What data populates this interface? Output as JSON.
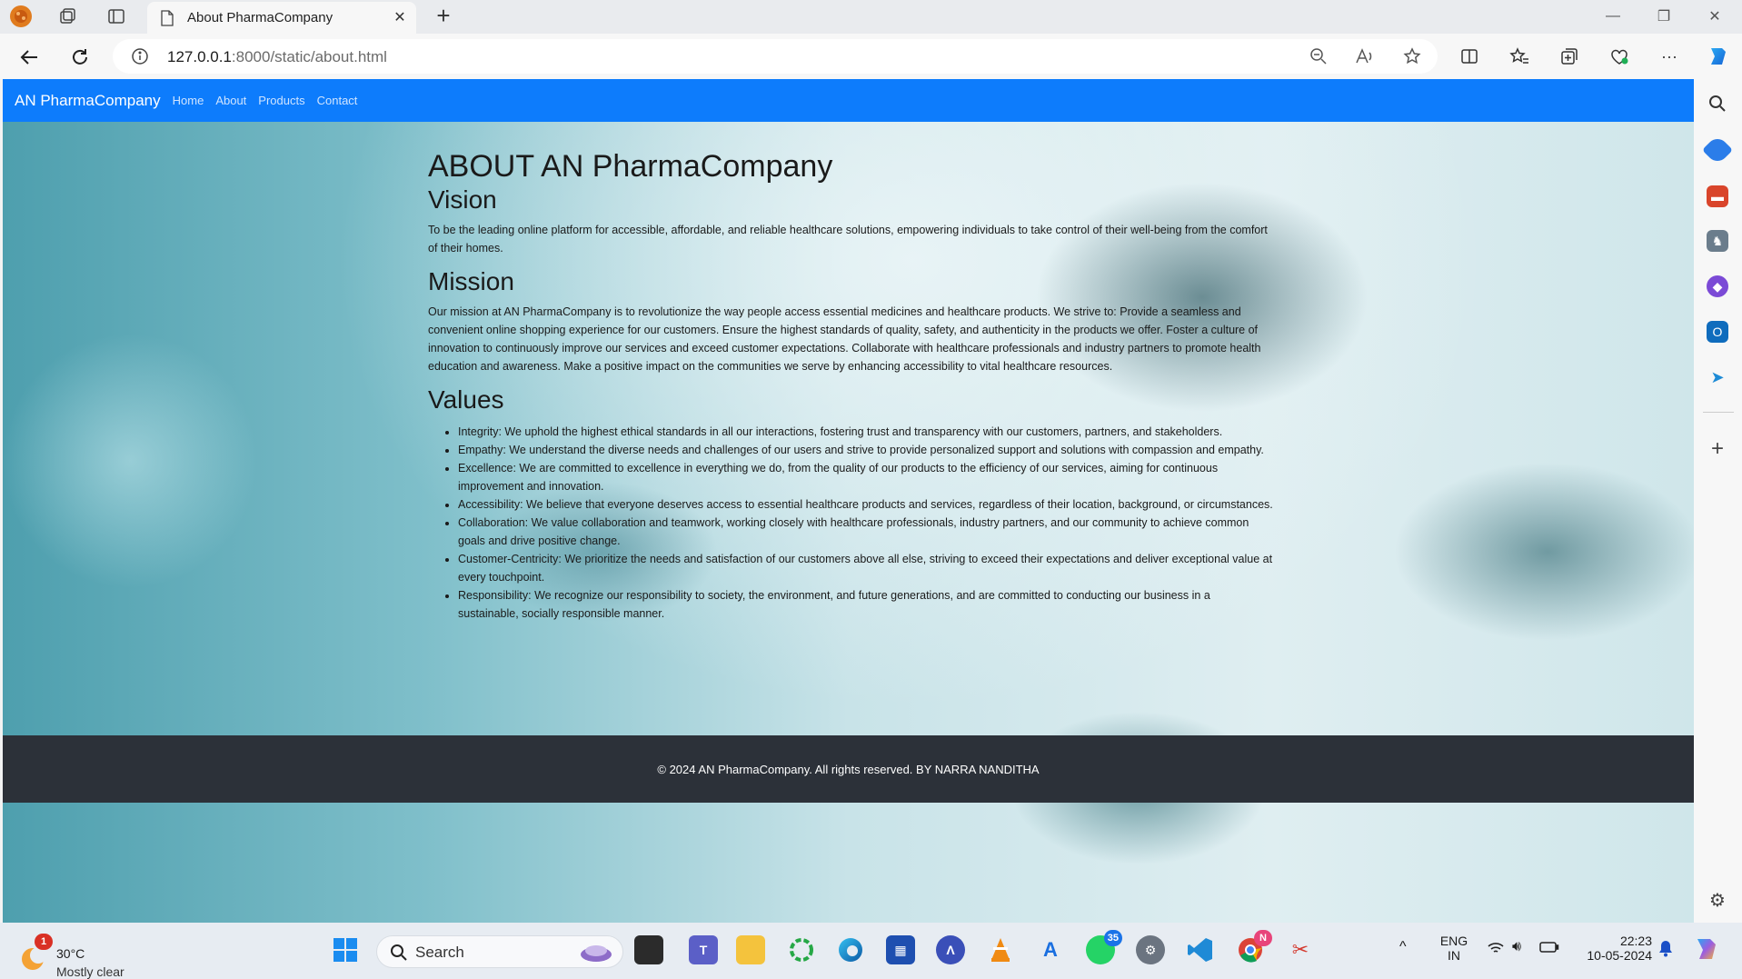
{
  "browser": {
    "tab_title": "About PharmaCompany",
    "url_host": "127.0.0.1",
    "url_rest": ":8000/static/about.html"
  },
  "site": {
    "brand": "AN PharmaCompany",
    "nav": [
      "Home",
      "About",
      "Products",
      "Contact"
    ],
    "title": "ABOUT AN PharmaCompany",
    "vision_heading": "Vision",
    "vision_text": "To be the leading online platform for accessible, affordable, and reliable healthcare solutions, empowering individuals to take control of their well-being from the comfort of their homes.",
    "mission_heading": "Mission",
    "mission_text": "Our mission at AN PharmaCompany is to revolutionize the way people access essential medicines and healthcare products. We strive to: Provide a seamless and convenient online shopping experience for our customers. Ensure the highest standards of quality, safety, and authenticity in the products we offer. Foster a culture of innovation to continuously improve our services and exceed customer expectations. Collaborate with healthcare professionals and industry partners to promote health education and awareness. Make a positive impact on the communities we serve by enhancing accessibility to vital healthcare resources.",
    "values_heading": "Values",
    "values": [
      "Integrity: We uphold the highest ethical standards in all our interactions, fostering trust and transparency with our customers, partners, and stakeholders.",
      "Empathy: We understand the diverse needs and challenges of our users and strive to provide personalized support and solutions with compassion and empathy.",
      "Excellence: We are committed to excellence in everything we do, from the quality of our products to the efficiency of our services, aiming for continuous improvement and innovation.",
      "Accessibility: We believe that everyone deserves access to essential healthcare products and services, regardless of their location, background, or circumstances.",
      "Collaboration: We value collaboration and teamwork, working closely with healthcare professionals, industry partners, and our community to achieve common goals and drive positive change.",
      "Customer-Centricity: We prioritize the needs and satisfaction of our customers above all else, striving to exceed their expectations and deliver exceptional value at every touchpoint.",
      "Responsibility: We recognize our responsibility to society, the environment, and future generations, and are committed to conducting our business in a sustainable, socially responsible manner."
    ],
    "footer": "© 2024 AN PharmaCompany. All rights reserved. BY NARRA NANDITHA"
  },
  "taskbar": {
    "weather_temp": "30°C",
    "weather_cond": "Mostly clear",
    "weather_badge": "1",
    "search_label": "Search",
    "whatsapp_badge": "35",
    "lang_top": "ENG",
    "lang_bottom": "IN",
    "time": "22:23",
    "date": "10-05-2024"
  },
  "colors": {
    "nav_bg": "#0d7cfc",
    "footer_bg": "#2c3139",
    "accent": "#1a73e8"
  }
}
